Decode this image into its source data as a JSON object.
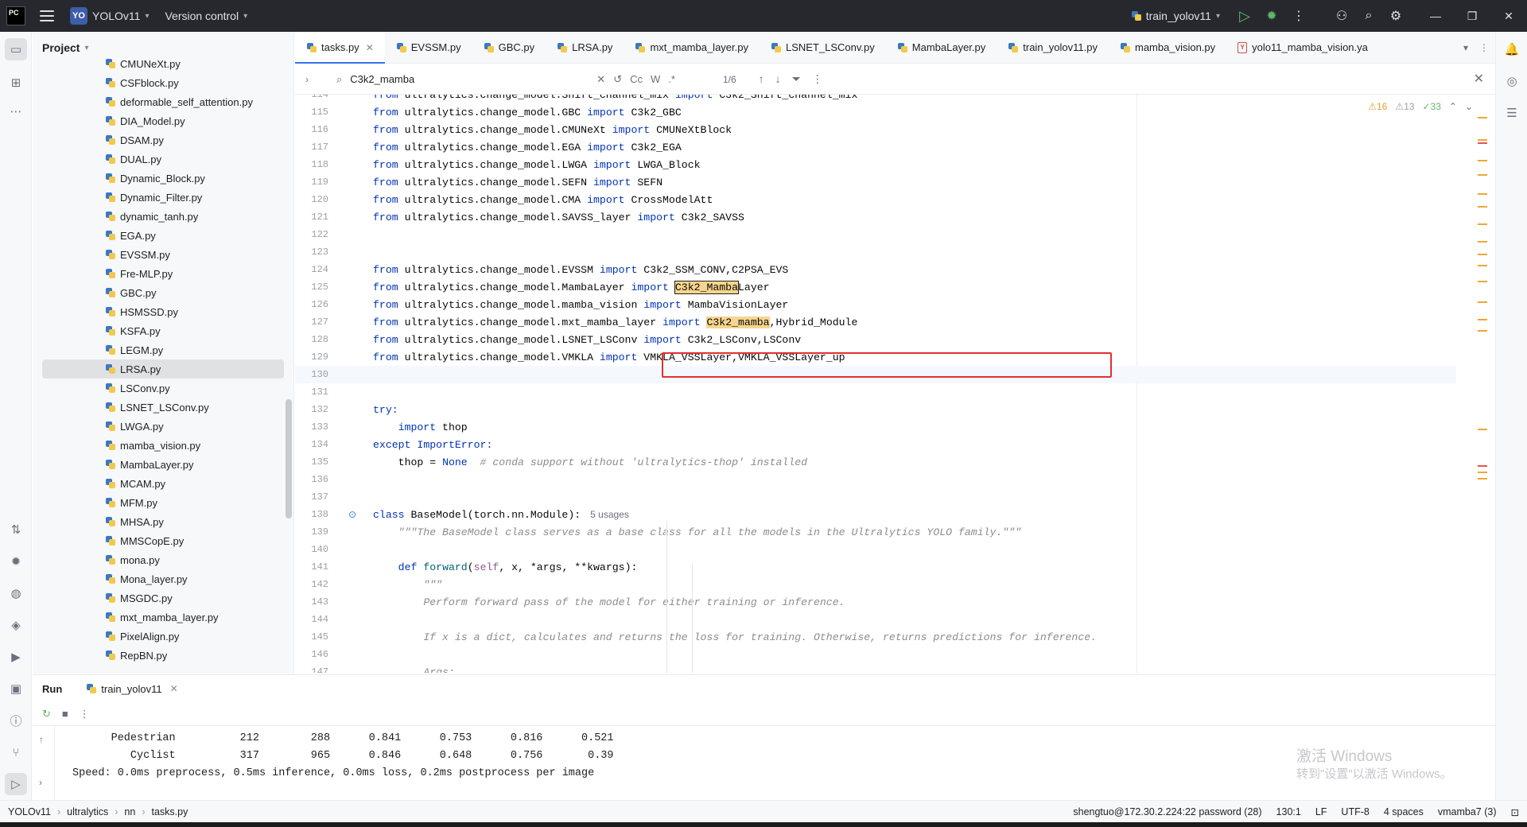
{
  "titlebar": {
    "app_logo": "PC",
    "project_badge": "YO",
    "project_name": "YOLOv11",
    "vcs_label": "Version control",
    "run_config": "train_yolov11"
  },
  "project_panel": {
    "title": "Project",
    "files": [
      "CMUNeXt.py",
      "CSFblock.py",
      "deformable_self_attention.py",
      "DIA_Model.py",
      "DSAM.py",
      "DUAL.py",
      "Dynamic_Block.py",
      "Dynamic_Filter.py",
      "dynamic_tanh.py",
      "EGA.py",
      "EVSSM.py",
      "Fre-MLP.py",
      "GBC.py",
      "HSMSSD.py",
      "KSFA.py",
      "LEGM.py",
      "LRSA.py",
      "LSConv.py",
      "LSNET_LSConv.py",
      "LWGA.py",
      "mamba_vision.py",
      "MambaLayer.py",
      "MCAM.py",
      "MFM.py",
      "MHSA.py",
      "MMSCopE.py",
      "mona.py",
      "Mona_layer.py",
      "MSGDC.py",
      "mxt_mamba_layer.py",
      "PixelAlign.py",
      "RepBN.py"
    ],
    "selected_file": "LRSA.py"
  },
  "tabs": [
    "tasks.py",
    "EVSSM.py",
    "GBC.py",
    "LRSA.py",
    "mxt_mamba_layer.py",
    "LSNET_LSConv.py",
    "MambaLayer.py",
    "train_yolov11.py",
    "mamba_vision.py",
    "yolo11_mamba_vision.ya"
  ],
  "active_tab": "tasks.py",
  "find": {
    "query": "C3k2_mamba",
    "count": "1/6",
    "opt_case": "Cc",
    "opt_word": "W",
    "opt_regex": ".*"
  },
  "inspections": {
    "warnings": "16",
    "weak": "13",
    "ok": "33"
  },
  "code": {
    "lines": [
      {
        "n": "115",
        "pre": "from",
        "mod": " ultralytics.change_model.GBC ",
        "imp": "import",
        "rest": " C3k2_GBC"
      },
      {
        "n": "116",
        "pre": "from",
        "mod": " ultralytics.change_model.CMUNeXt ",
        "imp": "import",
        "rest": " CMUNeXtBlock"
      },
      {
        "n": "117",
        "pre": "from",
        "mod": " ultralytics.change_model.EGA ",
        "imp": "import",
        "rest": " C3k2_EGA"
      },
      {
        "n": "118",
        "pre": "from",
        "mod": " ultralytics.change_model.LWGA ",
        "imp": "import",
        "rest": " LWGA_Block"
      },
      {
        "n": "119",
        "pre": "from",
        "mod": " ultralytics.change_model.SEFN ",
        "imp": "import",
        "rest": " SEFN"
      },
      {
        "n": "120",
        "pre": "from",
        "mod": " ultralytics.change_model.CMA ",
        "imp": "import",
        "rest": " CrossModelAtt"
      },
      {
        "n": "121",
        "pre": "from",
        "mod": " ultralytics.change_model.SAVSS_layer ",
        "imp": "import",
        "rest": " C3k2_SAVSS"
      },
      {
        "n": "124",
        "pre": "from",
        "mod": " ultralytics.change_model.EVSSM ",
        "imp": "import",
        "rest": " C3k2_SSM_CONV,C2PSA_EVS"
      },
      {
        "n": "126",
        "pre": "from",
        "mod": " ultralytics.change_model.mamba_vision ",
        "imp": "import",
        "rest": " MambaVisionLayer"
      },
      {
        "n": "128",
        "pre": "from",
        "mod": " ultralytics.change_model.LSNET_LSConv ",
        "imp": "import",
        "rest": " C3k2_LSConv,LSConv"
      },
      {
        "n": "129",
        "pre": "from",
        "mod": " ultralytics.change_model.VMKLA ",
        "imp": "import",
        "rest": " VMKLA_VSSLayer,VMKLA_VSSLayer_up"
      }
    ],
    "line114": "from ultralytics.change_model.Shift_channel_mix import C3k2_Shift_channel_mix",
    "line125": {
      "n": "125",
      "a": " ultralytics.change_model.MambaLayer ",
      "hl": "C3k2_Mamba",
      "tail": "Layer"
    },
    "line127": {
      "n": "127",
      "a": " ultralytics.change_model.mxt_mamba_layer ",
      "hl": "C3k2_mamba",
      "tail": ",Hybrid_Module"
    },
    "blank_numbers": [
      "122",
      "123",
      "130",
      "131",
      "136",
      "137",
      "140",
      "144",
      "146"
    ],
    "try_kw": "try:",
    "import_thop": "thop",
    "except_kw": "except",
    "import_error": "ImportError:",
    "thop_assign": "    thop = ",
    "none_kw": "None",
    "thop_comment": "  # conda support without 'ultralytics-thop' installed",
    "class_kw": "class",
    "class_decl": " BaseModel(torch.nn.Module):",
    "class_usages": "5 usages",
    "docstring": "\"\"\"The BaseModel class serves as a base class for all the models in the Ultralytics YOLO family.\"\"\"",
    "def_kw": "def",
    "def_name": "forward",
    "def_params_a": "(",
    "def_self": "self",
    "def_params_b": ", x, *args, **kwargs):",
    "doc_open": "\"\"\"",
    "doc_143": "Perform forward pass of the model for either training or inference.",
    "doc_145": "If x is a dict, calculates and returns the loss for training. Otherwise, returns predictions for inference.",
    "doc_147": "Args:"
  },
  "run": {
    "title": "Run",
    "tab": "train_yolov11",
    "rows": [
      {
        "cls": "Pedestrian",
        "images": "212",
        "instances": "288",
        "p": "0.841",
        "r": "0.753",
        "map50": "0.816",
        "map": "0.521"
      },
      {
        "cls": "Cyclist",
        "images": "317",
        "instances": "965",
        "p": "0.846",
        "r": "0.648",
        "map50": "0.756",
        "map": "0.39"
      }
    ],
    "speed": "Speed: 0.0ms preprocess, 0.5ms inference, 0.0ms loss, 0.2ms postprocess per image"
  },
  "watermark": {
    "line1": "激活 Windows",
    "line2": "转到\"设置\"以激活 Windows。"
  },
  "statusbar": {
    "breadcrumb": [
      "YOLOv11",
      "ultralytics",
      "nn",
      "tasks.py"
    ],
    "remote": "shengtuo@172.30.2.224:22 password (28)",
    "position": "130:1",
    "line_sep": "LF",
    "encoding": "UTF-8",
    "indent": "4 spaces",
    "interpreter": "vmamba7 (3)"
  }
}
